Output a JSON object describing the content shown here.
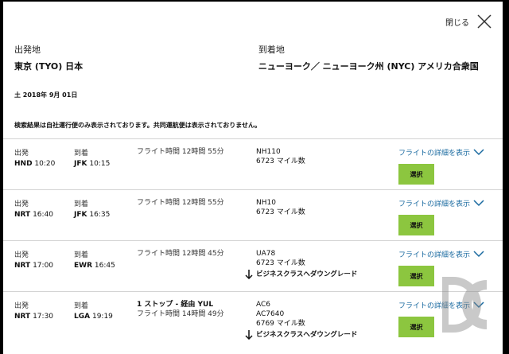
{
  "header": {
    "close_label": "閉じる"
  },
  "route": {
    "origin_label": "出発地",
    "origin_value": "東京 (TYO) 日本",
    "destination_label": "到着地",
    "destination_value": "ニューヨーク／ ニューヨーク州 (NYC) アメリカ合衆国"
  },
  "date": "土 2018年 9月 01日",
  "notice": "検索結果は自社運行便のみ表示されております。共同運航便は表示されておりません。",
  "labels": {
    "departure": "出発",
    "arrival": "到着",
    "details": "フライトの詳細を表示",
    "select": "選択"
  },
  "flights": [
    {
      "dep_airport": "HND",
      "dep_time": "10:20",
      "arr_airport": "JFK",
      "arr_time": "10:15",
      "stops": "",
      "duration": "フライト時間 12時間 55分",
      "flight_numbers": [
        "NH110"
      ],
      "miles": "6723 マイル数",
      "downgrade": ""
    },
    {
      "dep_airport": "NRT",
      "dep_time": "16:40",
      "arr_airport": "JFK",
      "arr_time": "16:35",
      "stops": "",
      "duration": "フライト時間 12時間 55分",
      "flight_numbers": [
        "NH10"
      ],
      "miles": "6723 マイル数",
      "downgrade": ""
    },
    {
      "dep_airport": "NRT",
      "dep_time": "17:00",
      "arr_airport": "EWR",
      "arr_time": "16:45",
      "stops": "",
      "duration": "フライト時間 12時間 45分",
      "flight_numbers": [
        "UA78"
      ],
      "miles": "6723 マイル数",
      "downgrade": "ビジネスクラスへダウングレード"
    },
    {
      "dep_airport": "NRT",
      "dep_time": "17:30",
      "arr_airport": "LGA",
      "arr_time": "19:19",
      "stops": "1 ストップ - 経由 YUL",
      "duration": "フライト時間 14時間 49分",
      "flight_numbers": [
        "AC6",
        "AC7640"
      ],
      "miles": "6769 マイル数",
      "downgrade": "ビジネスクラスへダウングレード"
    }
  ],
  "colors": {
    "select_button": "#8cc63f",
    "details_link": "#1a6aa0"
  },
  "icons": {
    "close": "close-icon",
    "chevron": "chevron-down-icon",
    "downgrade": "arrow-down-icon"
  }
}
